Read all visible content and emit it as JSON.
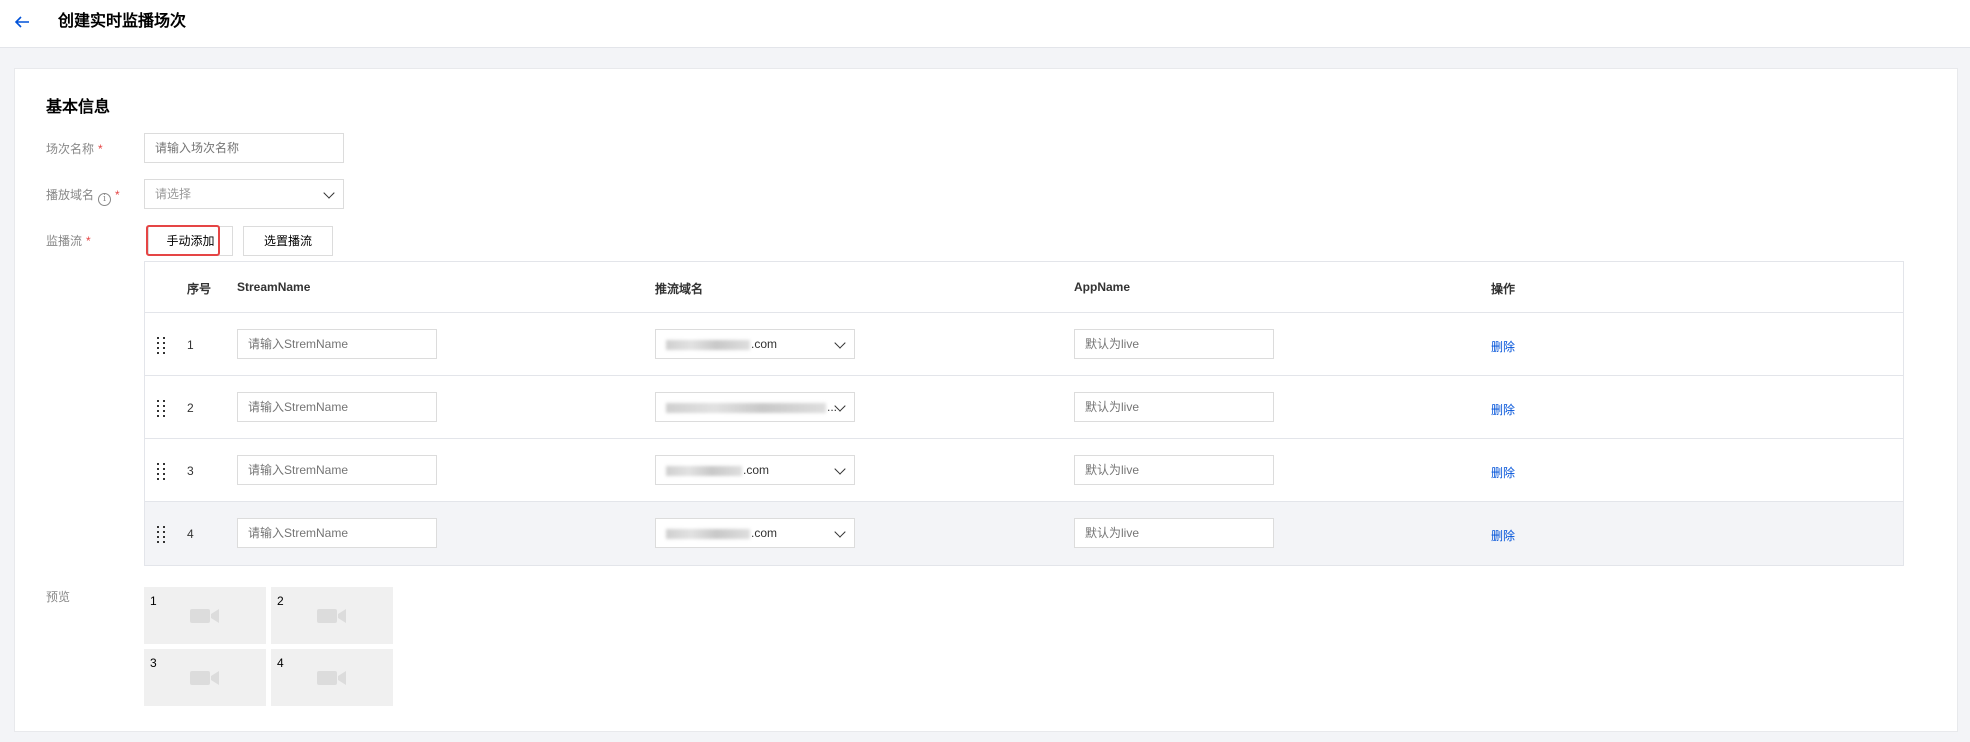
{
  "header": {
    "back_icon": "arrow-left-icon",
    "title": "创建实时监播场次"
  },
  "section_title": "基本信息",
  "form": {
    "session_name": {
      "label": "场次名称",
      "required": "*",
      "placeholder": "请输入场次名称",
      "value": ""
    },
    "play_domain": {
      "label": "播放域名",
      "info_icon": "info-icon",
      "required": "*",
      "placeholder": "请选择"
    },
    "monitor_stream": {
      "label": "监播流",
      "required": "*",
      "manual_add_label": "手动添加",
      "select_stream_label": "选置播流"
    }
  },
  "table": {
    "columns": [
      "序号",
      "StreamName",
      "推流域名",
      "AppName",
      "操作"
    ],
    "rows": [
      {
        "index": "1",
        "stream_placeholder": "请输入StremName",
        "domain_suffix": ".com",
        "app_placeholder": "默认为live",
        "action": "删除"
      },
      {
        "index": "2",
        "stream_placeholder": "请输入StremName",
        "domain_suffix": "...",
        "app_placeholder": "默认为live",
        "action": "删除"
      },
      {
        "index": "3",
        "stream_placeholder": "请输入StremName",
        "domain_suffix": ".com",
        "app_placeholder": "默认为live",
        "action": "删除"
      },
      {
        "index": "4",
        "stream_placeholder": "请输入StremName",
        "domain_suffix": ".com",
        "app_placeholder": "默认为live",
        "action": "删除"
      }
    ]
  },
  "preview": {
    "label": "预览",
    "tiles": [
      "1",
      "2",
      "3",
      "4"
    ],
    "tile_icon": "video-camera-icon"
  },
  "colors": {
    "accent": "#0052d9",
    "required": "#e54545",
    "background": "#f3f4f7"
  }
}
